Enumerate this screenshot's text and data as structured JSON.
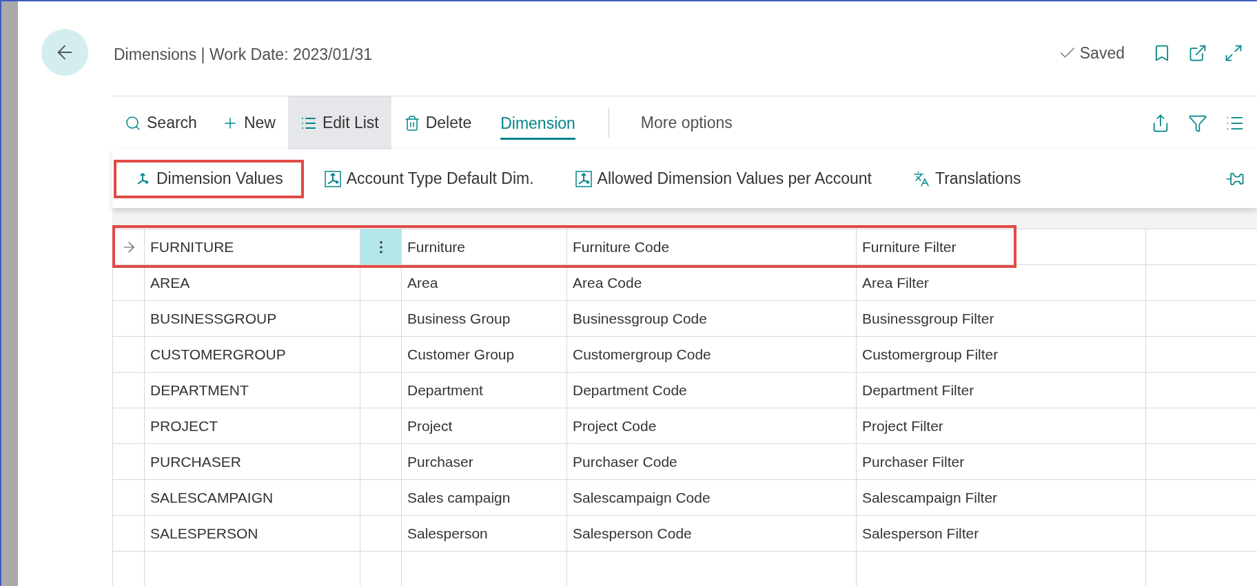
{
  "header": {
    "title": "Dimensions | Work Date: 2023/01/31",
    "status": "Saved"
  },
  "actions": [
    {
      "kind": "search",
      "label": "Search",
      "selected": false
    },
    {
      "kind": "new",
      "label": "New",
      "selected": false
    },
    {
      "kind": "edit",
      "label": "Edit List",
      "selected": true
    },
    {
      "kind": "delete",
      "label": "Delete",
      "selected": false
    },
    {
      "kind": "tab",
      "label": "Dimension",
      "selected": true
    },
    {
      "kind": "more",
      "label": "More options",
      "selected": false
    }
  ],
  "submenu": [
    {
      "kind": "dim",
      "label": "Dimension Values",
      "highlighted": true
    },
    {
      "kind": "dim",
      "label": "Account Type Default Dim.",
      "highlighted": false
    },
    {
      "kind": "dim",
      "label": "Allowed Dimension Values per Account",
      "highlighted": false
    },
    {
      "kind": "translate",
      "label": "Translations",
      "highlighted": false
    }
  ],
  "table": {
    "rows": [
      {
        "code": "FURNITURE",
        "name": "Furniture",
        "code_caption": "Furniture Code",
        "filter_caption": "Furniture Filter",
        "selected": true,
        "highlighted": true
      },
      {
        "code": "AREA",
        "name": "Area",
        "code_caption": "Area Code",
        "filter_caption": "Area Filter",
        "selected": false,
        "highlighted": false
      },
      {
        "code": "BUSINESSGROUP",
        "name": "Business Group",
        "code_caption": "Businessgroup Code",
        "filter_caption": "Businessgroup Filter",
        "selected": false,
        "highlighted": false
      },
      {
        "code": "CUSTOMERGROUP",
        "name": "Customer Group",
        "code_caption": "Customergroup Code",
        "filter_caption": "Customergroup Filter",
        "selected": false,
        "highlighted": false
      },
      {
        "code": "DEPARTMENT",
        "name": "Department",
        "code_caption": "Department Code",
        "filter_caption": "Department Filter",
        "selected": false,
        "highlighted": false
      },
      {
        "code": "PROJECT",
        "name": "Project",
        "code_caption": "Project Code",
        "filter_caption": "Project Filter",
        "selected": false,
        "highlighted": false
      },
      {
        "code": "PURCHASER",
        "name": "Purchaser",
        "code_caption": "Purchaser Code",
        "filter_caption": "Purchaser Filter",
        "selected": false,
        "highlighted": false
      },
      {
        "code": "SALESCAMPAIGN",
        "name": "Sales campaign",
        "code_caption": "Salescampaign Code",
        "filter_caption": "Salescampaign Filter",
        "selected": false,
        "highlighted": false
      },
      {
        "code": "SALESPERSON",
        "name": "Salesperson",
        "code_caption": "Salesperson Code",
        "filter_caption": "Salesperson Filter",
        "selected": false,
        "highlighted": false
      }
    ]
  }
}
